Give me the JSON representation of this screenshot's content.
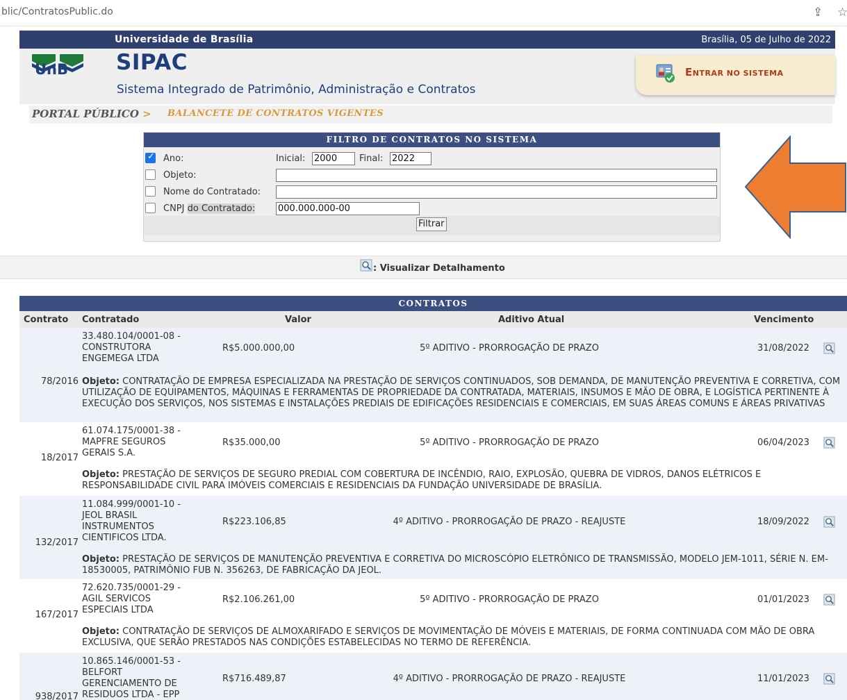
{
  "browser": {
    "url": "blic/ContratosPublic.do",
    "share_icon": "share-icon",
    "star_icon": "star-icon"
  },
  "header": {
    "university": "Universidade de Brasília",
    "date": "Brasília, 05 de Julho de 2022",
    "logo_text": "UnB",
    "app_name": "SIPAC",
    "app_subtitle": "Sistema Integrado de Patrimônio, Administração e Contratos",
    "login_label": "Entrar no sistema"
  },
  "breadcrumb": {
    "root": "PORTAL PÚBLICO",
    "separator": " > ",
    "current": "BALANCETE DE CONTRATOS VIGENTES"
  },
  "filter": {
    "title": "FILTRO DE CONTRATOS NO SISTEMA",
    "ano": {
      "label": "Ano:",
      "checked": true,
      "inicial_label": "Inicial:",
      "inicial_value": "2000",
      "final_label": "Final:",
      "final_value": "2022"
    },
    "objeto": {
      "label": "Objeto:",
      "checked": false,
      "value": ""
    },
    "nome": {
      "label": "Nome do Contratado:",
      "checked": false,
      "value": ""
    },
    "cnpj": {
      "label_a": "CNPJ ",
      "label_b": "do Contratado:",
      "checked": false,
      "value": "000.000.000-00"
    },
    "button": "Filtrar"
  },
  "legend": {
    "text": ": Visualizar Detalhamento"
  },
  "table": {
    "title": "CONTRATOS",
    "headers": {
      "contrato": "Contrato",
      "contratado": "Contratado",
      "valor": "Valor",
      "aditivo": "Aditivo Atual",
      "vencimento": "Vencimento"
    },
    "objeto_label": "Objeto:",
    "rows": [
      {
        "contrato": "78/2016",
        "contratado": "33.480.104/0001-08 -\nCONSTRUTORA\nENGEMEGA LTDA",
        "valor": "R$5.000.000,00",
        "aditivo": "5º ADITIVO - PRORROGAÇÃO DE PRAZO",
        "vencimento": "31/08/2022",
        "objeto": "CONTRATAÇÃO DE EMPRESA ESPECIALIZADA NA PRESTAÇÃO DE SERVIÇOS CONTINUADOS, SOB DEMANDA, DE MANUTENÇÃO PREVENTIVA E CORRETIVA, COM UTILIZAÇÃO DE EQUIPAMENTOS, MÁQUINAS E FERRAMENTAS DE PROPRIEDADE DA CONTRATADA, MATERIAIS, INSUMOS E MÃO DE OBRA, E LOGÍSTICA PERTINENTE À EXECUÇÃO DOS SERVIÇOS, NOS SISTEMAS E INSTALAÇÕES PREDIAIS DE EDIFICAÇÕES RESIDENCIAIS E COMERCIAIS, EM SUAS ÁREAS COMUNS E ÁREAS PRIVATIVAS"
      },
      {
        "contrato": "18/2017",
        "contratado": "61.074.175/0001-38 -\nMAPFRE SEGUROS\nGERAIS S.A.",
        "valor": "R$35.000,00",
        "aditivo": "5º ADITIVO - PRORROGAÇÃO DE PRAZO",
        "vencimento": "06/04/2023",
        "objeto": "PRESTAÇÃO DE SERVIÇOS DE SEGURO PREDIAL COM COBERTURA DE INCÊNDIO, RAIO, EXPLOSÃO, QUEBRA DE VIDROS, DANOS ELÉTRICOS E RESPONSABILIDADE CIVIL PARA IMÓVEIS COMERCIAIS E RESIDENCIAIS DA FUNDAÇÃO UNIVERSIDADE DE BRASÍLIA."
      },
      {
        "contrato": "132/2017",
        "contratado": "11.084.999/0001-10 -\nJEOL BRASIL\nINSTRUMENTOS\nCIENTIFICOS LTDA.",
        "valor": "R$223.106,85",
        "aditivo": "4º ADITIVO - PRORROGAÇÃO DE PRAZO - REAJUSTE",
        "vencimento": "18/09/2022",
        "objeto": "PRESTAÇÃO DE SERVIÇOS DE MANUTENÇÃO PREVENTIVA E CORRETIVA DO MICROSCÓPIO ELETRÔNICO DE TRANSMISSÃO, MODELO JEM-1011, SÉRIE N. EM-18530005, PATRIMÔNIO FUB N. 356263, DE FABRICAÇÃO DA JEOL."
      },
      {
        "contrato": "167/2017",
        "contratado": "72.620.735/0001-29 -\nAGIL SERVICOS\nESPECIAIS LTDA",
        "valor": "R$2.106.261,00",
        "aditivo": "5º ADITIVO - PRORROGAÇÃO DE PRAZO",
        "vencimento": "01/01/2023",
        "objeto": "CONTRATAÇÃO DE SERVIÇOS DE ALMOXARIFADO E SERVIÇOS DE MOVIMENTAÇÃO DE MÓVEIS E MATERIAIS, DE FORMA CONTINUADA COM MÃO DE OBRA EXCLUSIVA, QUE SERÃO PRESTADOS NAS CONDIÇÕES ESTABELECIDAS NO TERMO DE REFERÊNCIA."
      },
      {
        "contrato": "938/2017",
        "contratado": "10.865.146/0001-53 -\nBELFORT\nGERENCIAMENTO DE\nRESIDUOS LTDA - EPP",
        "valor": "R$716.489,87",
        "aditivo": "4º ADITIVO - PRORROGAÇÃO DE PRAZO - REAJUSTE",
        "vencimento": "11/01/2023",
        "objeto": ""
      }
    ]
  },
  "colors": {
    "header_bar": "#2f3f6e",
    "brand_blue": "#1f3f7c",
    "table_header": "#3b4f80",
    "arrow": "#ed7d31",
    "login_text": "#b23a1c",
    "breadcrumb_accent": "#d79a3a"
  }
}
